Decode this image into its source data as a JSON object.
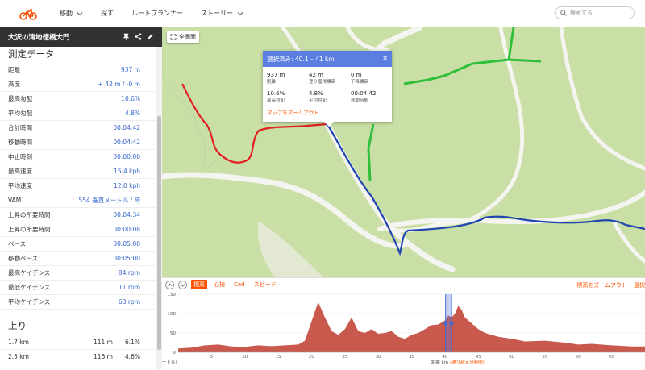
{
  "header": {
    "nav": [
      "移動",
      "探す",
      "ルートプランナー",
      "ストーリー"
    ],
    "search_placeholder": "検索する"
  },
  "route": {
    "title": "大沢の滝地徳橋大門"
  },
  "stats": {
    "title": "測定データ",
    "rows": [
      {
        "label": "距離",
        "value": "937 m"
      },
      {
        "label": "高度",
        "value": "+ 42 m / -0 m"
      },
      {
        "label": "最高勾配",
        "value": "10.6%"
      },
      {
        "label": "平均勾配",
        "value": "4.8%"
      },
      {
        "label": "合計時間",
        "value": "00:04:42"
      },
      {
        "label": "移動時間",
        "value": "00:04:42"
      },
      {
        "label": "中止時刻",
        "value": "00:00:00"
      },
      {
        "label": "最高速度",
        "value": "15.4 kph"
      },
      {
        "label": "平均速度",
        "value": "12.0 kph"
      },
      {
        "label": "VAM",
        "value": "554 垂直メートル / 時"
      },
      {
        "label": "上昇の所要時間",
        "value": "00:04:34"
      },
      {
        "label": "上昇の所要時間",
        "value": "00:00:08"
      },
      {
        "label": "ペース",
        "value": "00:05:00"
      },
      {
        "label": "移動ペース",
        "value": "00:05:00"
      },
      {
        "label": "最高ケイデンス",
        "value": "84 rpm"
      },
      {
        "label": "最低ケイデンス",
        "value": "11 rpm"
      },
      {
        "label": "平均ケイデンス",
        "value": "63 rpm"
      }
    ]
  },
  "climbs": {
    "title": "上り",
    "rows": [
      {
        "dist": "1.7 km",
        "elev": "111 m",
        "grade": "6.1%"
      },
      {
        "dist": "2.5 km",
        "elev": "116 m",
        "grade": "4.6%"
      }
    ]
  },
  "map": {
    "fullscreen_label": "全画面",
    "popup": {
      "title": "選択済み: 40.1 – 41 km",
      "metrics": [
        {
          "value": "937 m",
          "label": "距離"
        },
        {
          "value": "42 m",
          "label": "登り獲得標高"
        },
        {
          "value": "0 m",
          "label": "下降標高"
        },
        {
          "value": "10.6%",
          "label": "最高勾配"
        },
        {
          "value": "4.8%",
          "label": "平均勾配"
        },
        {
          "value": "00:04:42",
          "label": "移動時間"
        }
      ],
      "link": "マップをズームアウト"
    }
  },
  "elevation": {
    "tabs": [
      "標高",
      "心拍",
      "Cad",
      "スピード"
    ],
    "zoom_out": "標高をズームアウト",
    "cut_link": "選択",
    "y_ticks": [
      "150",
      "100",
      "50",
      "0"
    ],
    "x_ticks": [
      "5",
      "10",
      "15",
      "20",
      "25",
      "30",
      "35",
      "40",
      "45",
      "50",
      "55",
      "60",
      "65"
    ],
    "x_label": "距離 km",
    "x_label_extra": "(通り越え分時間)",
    "left_cut": "ートル)",
    "colors": {
      "fill": "#c9594d",
      "selection": "#3a6ad8",
      "route_red": "#e02020",
      "route_blue": "#1f45b0",
      "green_route": "#2fbf3b"
    }
  },
  "chart_data": {
    "type": "area",
    "xlabel": "距離 km",
    "ylabel": "",
    "xlim": [
      0,
      70
    ],
    "ylim": [
      0,
      150
    ],
    "selection": [
      40.1,
      41
    ],
    "x": [
      0,
      2,
      4,
      6,
      8,
      10,
      12,
      14,
      16,
      18,
      19,
      20,
      21,
      22,
      23,
      24,
      25,
      26,
      27,
      28,
      29,
      30,
      31,
      32,
      33,
      34,
      35,
      36,
      37,
      38,
      39,
      40,
      40.5,
      41,
      41.5,
      42,
      42.5,
      43,
      44,
      45,
      46,
      47,
      48,
      50,
      52,
      55,
      58,
      60,
      62,
      65,
      68,
      70
    ],
    "y": [
      10,
      12,
      18,
      20,
      15,
      14,
      18,
      16,
      18,
      20,
      30,
      80,
      130,
      90,
      55,
      45,
      60,
      90,
      55,
      50,
      60,
      48,
      50,
      55,
      40,
      35,
      45,
      50,
      60,
      70,
      72,
      82,
      95,
      90,
      100,
      120,
      110,
      90,
      75,
      60,
      50,
      45,
      40,
      35,
      28,
      30,
      25,
      20,
      22,
      18,
      15,
      15
    ]
  }
}
